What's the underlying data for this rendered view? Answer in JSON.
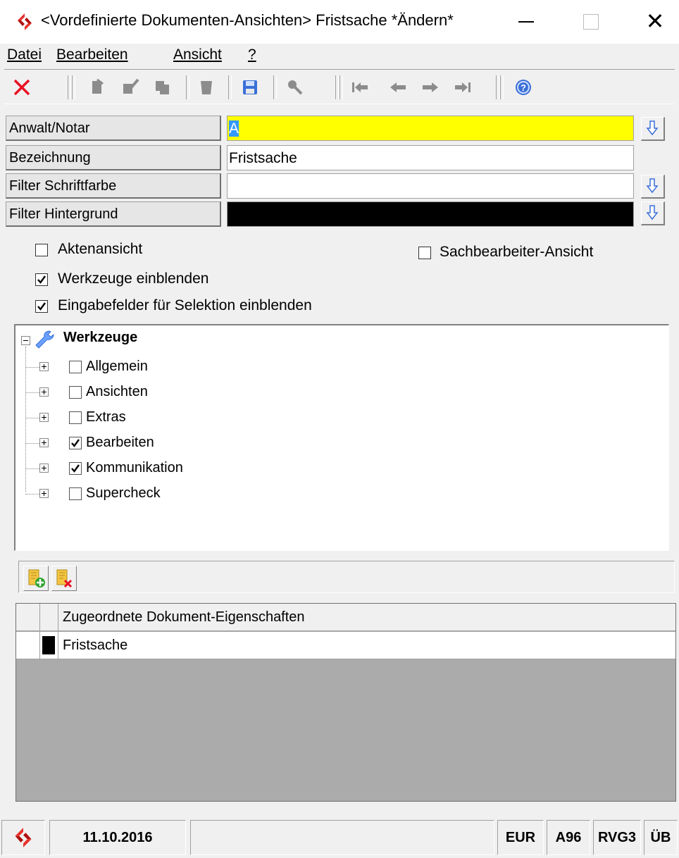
{
  "window": {
    "title": "<Vordefinierte Dokumenten-Ansichten> Fristsache *Ändern*",
    "close_glyph": "✕"
  },
  "menu": [
    {
      "label": "Datei"
    },
    {
      "label": "Bearbeiten"
    },
    {
      "label": "Ansicht"
    },
    {
      "label": "?"
    }
  ],
  "form": {
    "anwalt_label": "Anwalt/Notar",
    "anwalt_value": "A",
    "bezeichnung_label": "Bezeichnung",
    "bezeichnung_value": "Fristsache",
    "schriftfarbe_label": "Filter Schriftfarbe",
    "schriftfarbe_value": "",
    "hintergrund_label": "Filter Hintergrund",
    "hintergrund_color": "#000000",
    "anwalt_highlight_color": "#ffff00"
  },
  "options": {
    "aktenansicht": {
      "label": "Aktenansicht",
      "checked": false
    },
    "sachbearbeiter": {
      "label": "Sachbearbeiter-Ansicht",
      "checked": false
    },
    "werkzeuge": {
      "label": "Werkzeuge einblenden",
      "checked": true
    },
    "eingabefelder": {
      "label": "Eingabefelder für Selektion einblenden",
      "checked": true
    }
  },
  "tree": {
    "root_label": "Werkzeuge",
    "items": [
      {
        "label": "Allgemein",
        "checked": false
      },
      {
        "label": "Ansichten",
        "checked": false
      },
      {
        "label": "Extras",
        "checked": false
      },
      {
        "label": "Bearbeiten",
        "checked": true
      },
      {
        "label": "Kommunikation",
        "checked": true
      },
      {
        "label": "Supercheck",
        "checked": false
      }
    ]
  },
  "grid": {
    "header": "Zugeordnete Dokument-Eigenschaften",
    "rows": [
      {
        "label": "Fristsache",
        "color": "#000000"
      }
    ]
  },
  "status": {
    "date": "11.10.2016",
    "currency": "EUR",
    "a96": "A96",
    "rvg": "RVG3",
    "ub": "ÜB"
  },
  "colors": {
    "close_x": "#e81123",
    "toolbar_disabled": "#8c8c8c",
    "accent_blue": "#3a6fd8"
  }
}
